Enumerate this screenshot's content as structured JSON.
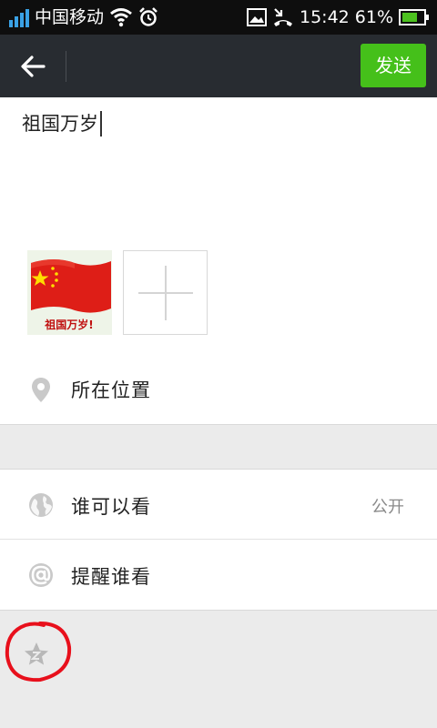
{
  "status_bar": {
    "carrier": "中国移动",
    "time": "15:42",
    "battery": "61%"
  },
  "title_bar": {
    "send_label": "发送"
  },
  "compose": {
    "text": "祖国万岁",
    "image_caption": "祖国万岁!"
  },
  "location": {
    "label": "所在位置"
  },
  "visibility": {
    "label": "谁可以看",
    "value": "公开"
  },
  "mention": {
    "label": "提醒谁看"
  },
  "colors": {
    "send_button": "#45c01a",
    "title_bar": "#282c31",
    "status_bar": "#0e0e0e",
    "annotation_circle": "#e8101c"
  }
}
